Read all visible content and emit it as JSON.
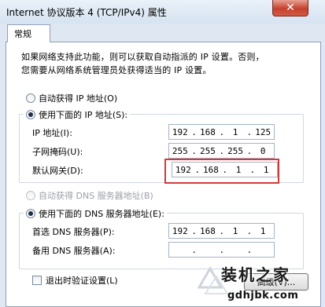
{
  "window": {
    "title": "Internet 协议版本 4 (TCP/IPv4) 属性",
    "close_label": "✕"
  },
  "tab": {
    "label": "常规"
  },
  "description": {
    "line1": "如果网络支持此功能，则可以获取自动指派的 IP 设置。否则，",
    "line2": "您需要从网络系统管理员处获得适当的 IP 设置。"
  },
  "ip_section": {
    "auto_label": "自动获得 IP 地址(O)",
    "manual_label": "使用下面的 IP 地址(S):",
    "selected": "manual",
    "fields": [
      {
        "label": "IP 地址(I):",
        "octets": [
          "192",
          "168",
          "1",
          "125"
        ]
      },
      {
        "label": "子网掩码(U):",
        "octets": [
          "255",
          "255",
          "255",
          "0"
        ]
      },
      {
        "label": "默认网关(D):",
        "octets": [
          "192",
          "168",
          "1",
          "1"
        ]
      }
    ]
  },
  "dns_section": {
    "auto_label": "自动获得 DNS 服务器地址(B)",
    "manual_label": "使用下面的 DNS 服务器地址(E):",
    "selected": "manual",
    "fields": [
      {
        "label": "首选 DNS 服务器(P):",
        "octets": [
          "192",
          "168",
          "1",
          "1"
        ]
      },
      {
        "label": "备用 DNS 服务器(A):",
        "octets": [
          "",
          "",
          "",
          ""
        ]
      }
    ]
  },
  "validate_checkbox": {
    "label": "退出时验证设置(L)",
    "checked": false
  },
  "advanced_button": {
    "label": "高级(V)..."
  },
  "watermark": {
    "text": "装机之家",
    "url": "gdhjbk.com"
  },
  "colors": {
    "highlight": "#d33a3a",
    "close": "#c4412c"
  }
}
